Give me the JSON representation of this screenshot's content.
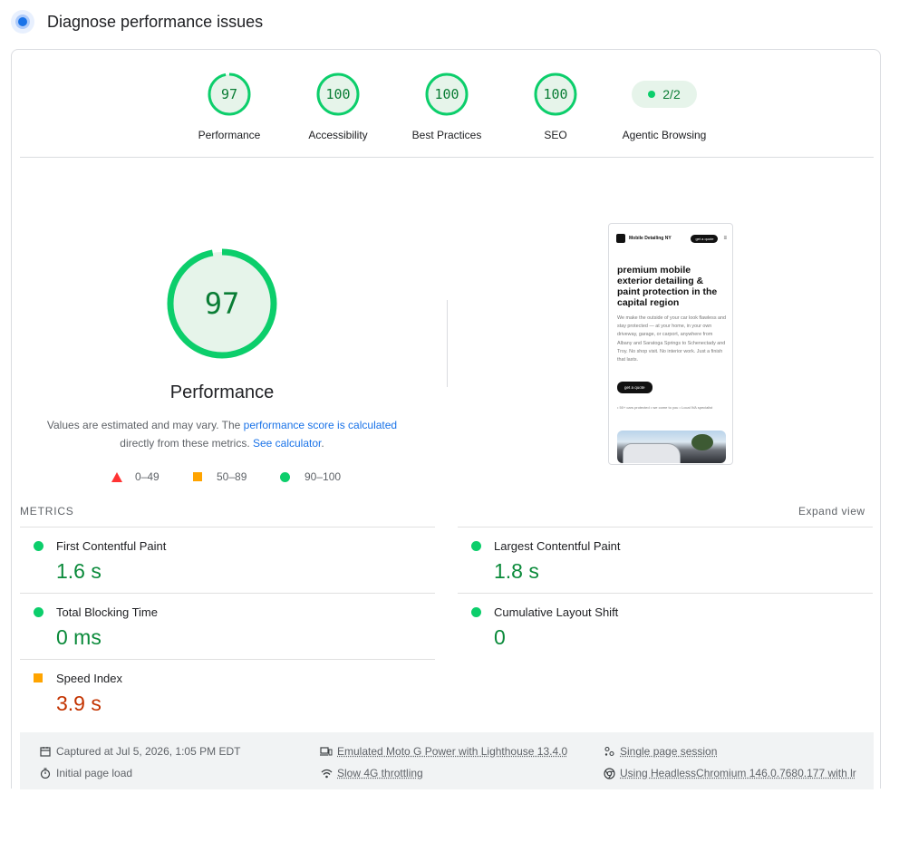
{
  "header": {
    "title": "Diagnose performance issues"
  },
  "categories": [
    {
      "score": "97",
      "label": "Performance",
      "fraction": 0.97
    },
    {
      "score": "100",
      "label": "Accessibility",
      "fraction": 1.0
    },
    {
      "score": "100",
      "label": "Best Practices",
      "fraction": 1.0
    },
    {
      "score": "100",
      "label": "SEO",
      "fraction": 1.0
    },
    {
      "score": "2/2",
      "label": "Agentic Browsing"
    }
  ],
  "performance": {
    "score": "97",
    "fraction": 0.97,
    "title": "Performance",
    "desc_prefix": "Values are estimated and may vary. The ",
    "desc_link1": "performance score is calculated",
    "desc_mid": "directly from these metrics. ",
    "desc_link2": "See calculator",
    "desc_suffix": "."
  },
  "legend": {
    "fail": "0–49",
    "average": "50–89",
    "pass": "90–100"
  },
  "screenshot": {
    "brand": "Mobile Detailing NY",
    "cta": "get a quote",
    "menu": "≡",
    "headline": "premium mobile exterior detailing & paint protection in the capital region",
    "body": "We make the outside of your car look flawless and stay protected — at your home, in your own driveway, garage, or carport, anywhere from Albany and Saratoga Springs to Schenectady and Troy. No shop visit. No interior work. Just a finish that lasts.",
    "button": "get a quote",
    "chips": "• 50+ cars protected   • we come to you   • Local IVA specialist"
  },
  "metrics": {
    "heading": "METRICS",
    "expand": "Expand view",
    "items": [
      {
        "name": "First Contentful Paint",
        "value": "1.6 s",
        "rating": "pass"
      },
      {
        "name": "Largest Contentful Paint",
        "value": "1.8 s",
        "rating": "pass"
      },
      {
        "name": "Total Blocking Time",
        "value": "0 ms",
        "rating": "pass"
      },
      {
        "name": "Cumulative Layout Shift",
        "value": "0",
        "rating": "pass"
      },
      {
        "name": "Speed Index",
        "value": "3.9 s",
        "rating": "average"
      }
    ]
  },
  "footer": {
    "captured": "Captured at Jul 5, 2026, 1:05 PM EDT",
    "load": "Initial page load",
    "device": "Emulated Moto G Power with Lighthouse 13.4.0",
    "throttling": "Slow 4G throttling",
    "session": "Single page session",
    "browser": "Using HeadlessChromium 146.0.7680.177 with lr"
  },
  "colors": {
    "pass": "#0cce6b",
    "average": "#ffa400",
    "fail": "#ff3333",
    "link": "#1a73e8"
  }
}
